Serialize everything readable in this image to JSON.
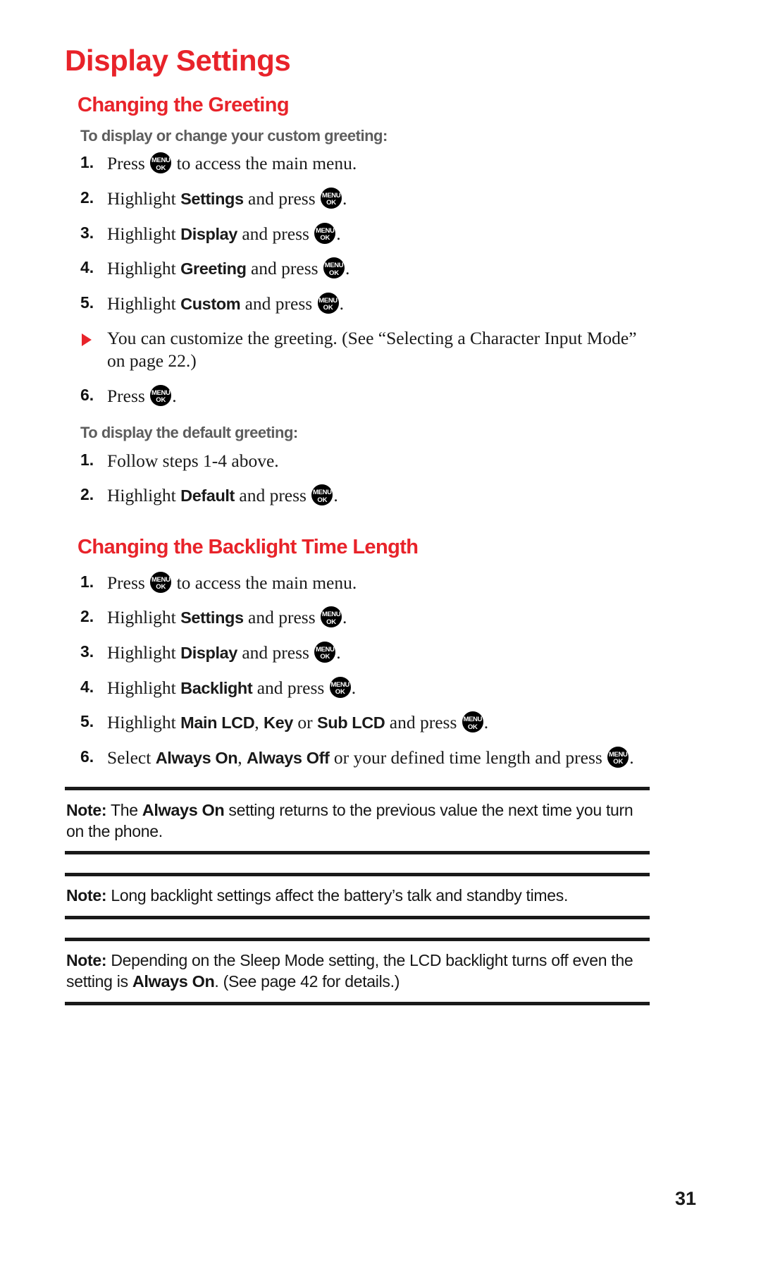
{
  "page": {
    "title": "Display Settings",
    "number": "31",
    "accent_color": "#e8232a",
    "subheading_color": "#5d5d5d",
    "text_color": "#1a1a1a"
  },
  "icons": {
    "menu_ok": {
      "name": "menu-ok-key-icon",
      "top": "MENU",
      "bottom": "OK"
    },
    "bullet": {
      "name": "triangle-bullet-icon",
      "glyph": "▶"
    }
  },
  "sections": [
    {
      "heading": "Changing the Greeting",
      "subsections": [
        {
          "subheading": "To display or change your custom greeting:",
          "items": [
            {
              "type": "step",
              "num": "1.",
              "parts": [
                {
                  "t": "text",
                  "v": "Press "
                },
                {
                  "t": "key"
                },
                {
                  "t": "text",
                  "v": " to access the main menu."
                }
              ]
            },
            {
              "type": "step",
              "num": "2.",
              "parts": [
                {
                  "t": "text",
                  "v": "Highlight "
                },
                {
                  "t": "bold",
                  "v": "Settings"
                },
                {
                  "t": "text",
                  "v": " and press "
                },
                {
                  "t": "key"
                },
                {
                  "t": "text",
                  "v": "."
                }
              ]
            },
            {
              "type": "step",
              "num": "3.",
              "parts": [
                {
                  "t": "text",
                  "v": "Highlight "
                },
                {
                  "t": "bold",
                  "v": "Display"
                },
                {
                  "t": "text",
                  "v": " and press "
                },
                {
                  "t": "key"
                },
                {
                  "t": "text",
                  "v": "."
                }
              ]
            },
            {
              "type": "step",
              "num": "4.",
              "parts": [
                {
                  "t": "text",
                  "v": "Highlight "
                },
                {
                  "t": "bold",
                  "v": "Greeting"
                },
                {
                  "t": "text",
                  "v": " and press "
                },
                {
                  "t": "key"
                },
                {
                  "t": "text",
                  "v": "."
                }
              ]
            },
            {
              "type": "step",
              "num": "5.",
              "parts": [
                {
                  "t": "text",
                  "v": "Highlight "
                },
                {
                  "t": "bold",
                  "v": "Custom"
                },
                {
                  "t": "text",
                  "v": " and press "
                },
                {
                  "t": "key"
                },
                {
                  "t": "text",
                  "v": "."
                }
              ]
            },
            {
              "type": "bullet",
              "parts": [
                {
                  "t": "text",
                  "v": "You can customize the greeting. (See “Selecting a Character Input Mode” on page 22.)"
                }
              ]
            },
            {
              "type": "step",
              "num": "6.",
              "parts": [
                {
                  "t": "text",
                  "v": "Press "
                },
                {
                  "t": "key"
                },
                {
                  "t": "text",
                  "v": "."
                }
              ]
            }
          ]
        },
        {
          "subheading": "To display the default greeting:",
          "items": [
            {
              "type": "step",
              "num": "1.",
              "parts": [
                {
                  "t": "text",
                  "v": "Follow steps 1-4 above."
                }
              ]
            },
            {
              "type": "step",
              "num": "2.",
              "parts": [
                {
                  "t": "text",
                  "v": "Highlight "
                },
                {
                  "t": "bold",
                  "v": "Default"
                },
                {
                  "t": "text",
                  "v": " and press "
                },
                {
                  "t": "key"
                },
                {
                  "t": "text",
                  "v": "."
                }
              ]
            }
          ]
        }
      ]
    },
    {
      "heading": "Changing the Backlight Time Length",
      "subsections": [
        {
          "subheading": "",
          "items": [
            {
              "type": "step",
              "num": "1.",
              "parts": [
                {
                  "t": "text",
                  "v": "Press "
                },
                {
                  "t": "key"
                },
                {
                  "t": "text",
                  "v": " to access the main menu."
                }
              ]
            },
            {
              "type": "step",
              "num": "2.",
              "parts": [
                {
                  "t": "text",
                  "v": "Highlight "
                },
                {
                  "t": "bold",
                  "v": "Settings"
                },
                {
                  "t": "text",
                  "v": " and press "
                },
                {
                  "t": "key"
                },
                {
                  "t": "text",
                  "v": "."
                }
              ]
            },
            {
              "type": "step",
              "num": "3.",
              "parts": [
                {
                  "t": "text",
                  "v": "Highlight "
                },
                {
                  "t": "bold",
                  "v": "Display"
                },
                {
                  "t": "text",
                  "v": " and press "
                },
                {
                  "t": "key"
                },
                {
                  "t": "text",
                  "v": "."
                }
              ]
            },
            {
              "type": "step",
              "num": "4.",
              "parts": [
                {
                  "t": "text",
                  "v": "Highlight "
                },
                {
                  "t": "bold",
                  "v": "Backlight"
                },
                {
                  "t": "text",
                  "v": " and press "
                },
                {
                  "t": "key"
                },
                {
                  "t": "text",
                  "v": "."
                }
              ]
            },
            {
              "type": "step",
              "num": "5.",
              "parts": [
                {
                  "t": "text",
                  "v": "Highlight "
                },
                {
                  "t": "bold",
                  "v": "Main LCD"
                },
                {
                  "t": "text",
                  "v": ", "
                },
                {
                  "t": "bold",
                  "v": "Key"
                },
                {
                  "t": "text",
                  "v": " or "
                },
                {
                  "t": "bold",
                  "v": "Sub LCD"
                },
                {
                  "t": "text",
                  "v": " and press "
                },
                {
                  "t": "key"
                },
                {
                  "t": "text",
                  "v": "."
                }
              ]
            },
            {
              "type": "step",
              "num": "6.",
              "parts": [
                {
                  "t": "text",
                  "v": "Select "
                },
                {
                  "t": "bold",
                  "v": "Always On"
                },
                {
                  "t": "text",
                  "v": ", "
                },
                {
                  "t": "bold",
                  "v": "Always Off"
                },
                {
                  "t": "text",
                  "v": " or your defined time length and press "
                },
                {
                  "t": "key"
                },
                {
                  "t": "text",
                  "v": "."
                }
              ]
            }
          ]
        }
      ]
    }
  ],
  "notes": [
    {
      "parts": [
        {
          "t": "label",
          "v": "Note:"
        },
        {
          "t": "text",
          "v": " The "
        },
        {
          "t": "bold",
          "v": "Always On"
        },
        {
          "t": "text",
          "v": " setting returns to the previous value the next time you turn on the phone."
        }
      ]
    },
    {
      "parts": [
        {
          "t": "label",
          "v": "Note:"
        },
        {
          "t": "text",
          "v": " Long backlight settings affect the battery’s talk and standby times."
        }
      ]
    },
    {
      "parts": [
        {
          "t": "label",
          "v": "Note:"
        },
        {
          "t": "text",
          "v": " Depending on the Sleep Mode setting, the LCD backlight turns off even the setting is "
        },
        {
          "t": "bold",
          "v": "Always On"
        },
        {
          "t": "text",
          "v": ". (See page 42 for details.)"
        }
      ]
    }
  ]
}
